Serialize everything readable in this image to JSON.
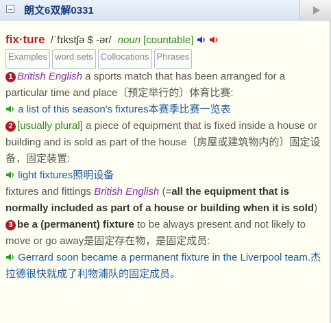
{
  "header": {
    "title": "朗文6双解0331"
  },
  "entry": {
    "headword": "fix·ture",
    "pronunciation": "/ˈfɪkstʃə $ -ər/",
    "pos": "noun",
    "grammar": "[countable]",
    "speaker_icons": [
      "speaker-blue-icon",
      "speaker-red-icon"
    ],
    "tags": [
      "Examples",
      "word sets",
      "Collocations",
      "Phrases"
    ],
    "senses": [
      {
        "number": "1",
        "region": "British English",
        "definition": "a sports match that has been arranged for a particular time and place〔预定举行的〕体育比赛:",
        "example": "a list of this season's fixtures本赛季比赛一览表"
      },
      {
        "number": "2",
        "grammar": "[usually plural]",
        "definition": "a piece of equipment that is fixed inside a house or building and is sold as part of the house〔房屋或建筑物内的〕固定设备，固定装置:",
        "example": "light fixtures照明设备",
        "phrase": "fixtures and fittings",
        "phrase_region": "British English",
        "phrase_open": "(=",
        "phrase_def": "all the equipment that is normally included as part of a house or building when it is sold",
        "phrase_close": ")"
      },
      {
        "number": "3",
        "bold": "be a (permanent) fixture",
        "definition": "to be always present and not likely to move or go away是固定存在物，是固定成员:",
        "example": "Gerrard soon became a permanent fixture in the Liverpool team.杰拉德很快就成了利物浦队的固定成员。"
      }
    ]
  },
  "colors": {
    "headword": "#b8222a",
    "region": "#8a2aa6",
    "grammar": "#2a8a22",
    "example": "#1a5a9e",
    "sense_number_bg": "#b0182a"
  }
}
